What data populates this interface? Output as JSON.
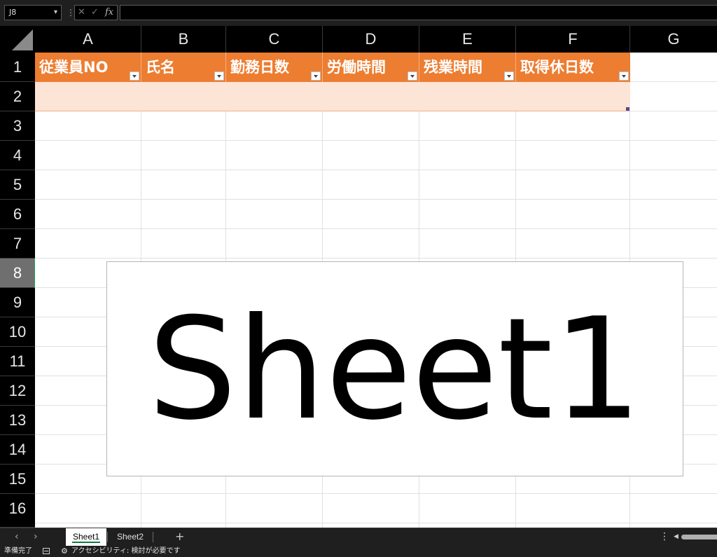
{
  "formula_bar": {
    "name_box": "J8",
    "separator_glyph": "⋮",
    "cancel_glyph": "✕",
    "enter_glyph": "✓",
    "fx_label": "fx",
    "formula": ""
  },
  "columns": [
    "A",
    "B",
    "C",
    "D",
    "E",
    "F",
    "G"
  ],
  "rows": [
    "1",
    "2",
    "3",
    "4",
    "5",
    "6",
    "7",
    "8",
    "9",
    "10",
    "11",
    "12",
    "13",
    "14",
    "15",
    "16"
  ],
  "active_row": "8",
  "table": {
    "header_color": "#ed7d31",
    "band_color": "#fce4d6",
    "headers": [
      "従業員NO",
      "氏名",
      "勤務日数",
      "労働時間",
      "残業時間",
      "取得休日数"
    ]
  },
  "shape": {
    "text": "Sheet1"
  },
  "tabs": {
    "prev": "‹",
    "next": "›",
    "sheets": [
      "Sheet1",
      "Sheet2"
    ],
    "active": "Sheet1",
    "add": "+",
    "more": "⋮",
    "scroll_left": "◀"
  },
  "status": {
    "ready": "準備完了",
    "accessibility_glyph": "⚙",
    "accessibility": "アクセシビリティ: 検討が必要です"
  },
  "colors": {
    "accent_green": "#107c41",
    "selection_green": "#21a366"
  }
}
